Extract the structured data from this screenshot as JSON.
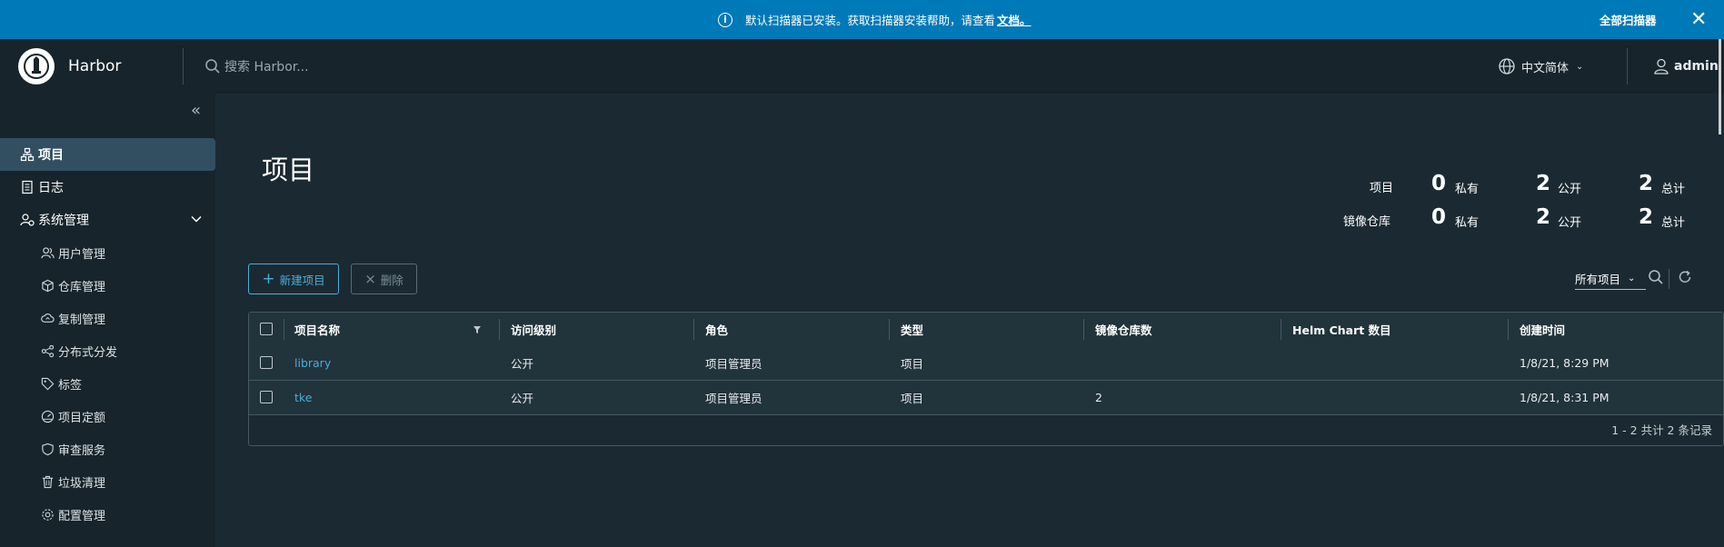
{
  "banner": {
    "message": "默认扫描器已安装。获取扫描器安装帮助，请查看",
    "link": "文档。",
    "action": "全部扫描器",
    "close": "✕"
  },
  "header": {
    "brand": "Harbor",
    "search_placeholder": "搜索 Harbor...",
    "language": "中文简体",
    "user": "admin"
  },
  "sidebar": {
    "items": [
      {
        "label": "项目",
        "icon": "projects-icon",
        "active": true
      },
      {
        "label": "日志",
        "icon": "logs-icon"
      },
      {
        "label": "系统管理",
        "icon": "system-admin-icon"
      }
    ],
    "sub_items": [
      {
        "label": "用户管理",
        "icon": "users-icon"
      },
      {
        "label": "仓库管理",
        "icon": "registry-icon"
      },
      {
        "label": "复制管理",
        "icon": "replication-icon"
      },
      {
        "label": "分布式分发",
        "icon": "distribution-icon"
      },
      {
        "label": "标签",
        "icon": "tag-icon"
      },
      {
        "label": "项目定额",
        "icon": "quota-icon"
      },
      {
        "label": "审查服务",
        "icon": "shield-icon"
      },
      {
        "label": "垃圾清理",
        "icon": "trash-icon"
      },
      {
        "label": "配置管理",
        "icon": "gear-icon"
      }
    ]
  },
  "main": {
    "title": "项目",
    "stats": {
      "projects_label": "项目",
      "repos_label": "镜像仓库",
      "project_private": "0",
      "project_public": "2",
      "project_total": "2",
      "repo_private": "0",
      "repo_public": "2",
      "repo_total": "2",
      "private_unit": "私有",
      "public_unit": "公开",
      "total_unit": "总计"
    },
    "toolbar": {
      "new_label": "新建项目",
      "delete_label": "删除",
      "filter_value": "所有项目"
    },
    "table": {
      "columns": [
        "项目名称",
        "访问级别",
        "角色",
        "类型",
        "镜像仓库数",
        "Helm Chart 数目",
        "创建时间"
      ],
      "rows": [
        [
          "library",
          "公开",
          "项目管理员",
          "项目",
          "",
          "",
          "1/8/21, 8:29 PM"
        ],
        [
          "tke",
          "公开",
          "项目管理员",
          "项目",
          "2",
          "",
          "1/8/21, 8:31 PM"
        ]
      ],
      "footer": "1 - 2 共计 2 条记录"
    }
  },
  "colors": {
    "banner": "#0079b8",
    "header": "#17242b",
    "background": "#1b2a32",
    "accent": "#49afd9"
  }
}
